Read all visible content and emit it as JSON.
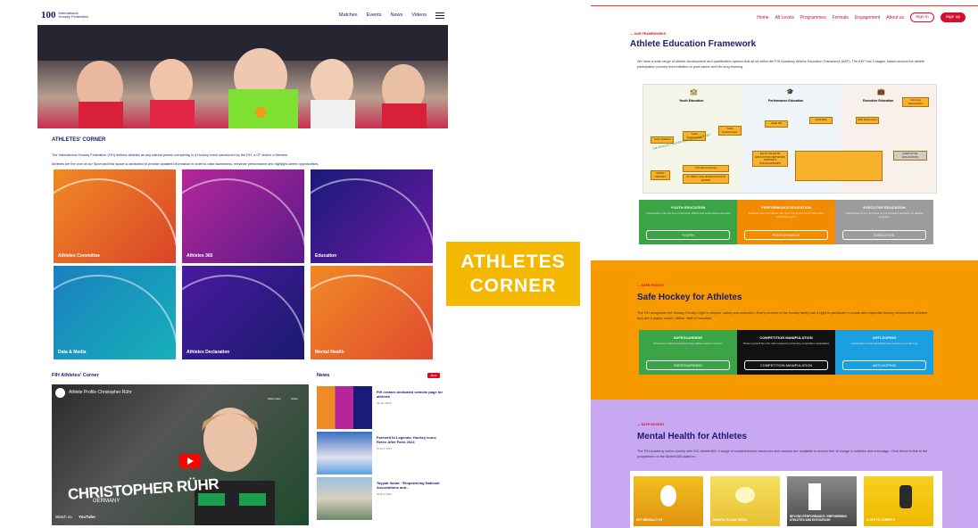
{
  "left": {
    "logo": {
      "number": "100",
      "text": "International Hockey Federation"
    },
    "nav": [
      "Matches",
      "Events",
      "News",
      "Videos"
    ],
    "section_title": "ATHLETES' CORNER",
    "intro1": "The International Hockey Federation (FIH) defines athletes as any natural person competing in a Hockey event sanctioned by the FIH, a CF and/or a Member",
    "intro2": "Athletes are the core of our Sport and this space is dedicated to provide updated information in order to raise awareness, enhance performance and highlight career opportunities.",
    "tiles": [
      "Athletes Committee",
      "Athletes 365",
      "Education",
      "Data & Media",
      "Athletes Declaration",
      "Mental Health"
    ],
    "corner_title": "FIH Athletes' Corner",
    "video": {
      "title": "Athlete Profile Christopher Rühr",
      "name": "CHRISTOPHER RÜHR",
      "country": "GERMANY",
      "watch": "Watch on",
      "yt": "YouTube",
      "later": "Watch later",
      "share": "Share"
    },
    "news_title": "News",
    "news_more": "More",
    "news": [
      {
        "title": "FIH creates dedicated website page for athletes",
        "date": "02 Jan 2025"
      },
      {
        "title": "Farewell to Legends: Hockey Icons Retire After Paris 2024",
        "date": "15 Dec 2024"
      },
      {
        "title": "Tayyab Ikram: \"Empowering National Associations and...",
        "date": "05 Dec 2024"
      }
    ]
  },
  "badge": {
    "line1": "ATHLETES",
    "line2": "CORNER"
  },
  "right": {
    "nav": [
      "Home",
      "All Levels",
      "Programmes",
      "Formats",
      "Engagement",
      "About us"
    ],
    "signin": "Sign in",
    "signup": "Sign up",
    "aef": {
      "eyebrow": "— OUR FRAMEWORKS",
      "title": "Athlete Education Framework",
      "desc": "We have a wide range of athlete development and qualification options that all sit within the FIH Academy Athlete Education Framework (AEF). The AEF has 3 stages, based around the athlete participation journey from initiation to post career and life-long learning.",
      "diagram": {
        "stages": [
          "Youth Education",
          "Performance Education",
          "Executive Education"
        ],
        "boxes": [
          "Youth Initiation",
          "Youth Intermediate",
          "Youth Performance",
          "Adult HP",
          "Adult Elite",
          "Elite Retirement",
          "Life-long Participation"
        ],
        "journey": "THE ATHLETE / PLAYER EDUCATION JOURNEY",
        "start": "START HOCKEY",
        "camps": "FIH World Camps",
        "olympic": "OLYMPIC VALUES EDUCATION (OVEP)",
        "elite": "ELITE ATHLETE EDUCATION NETWORK SUPPORT SCHOLARSHIPS",
        "exec": "EXECUTIVE EDUCATION"
      },
      "cards": [
        {
          "title": "YOUTH EDUCATION",
          "desc": "Gold/Golden is the first area of personal, athletic and performance education",
          "button": "YOUTH",
          "color": "#3aa446"
        },
        {
          "title": "PERFORMANCE EDUCATION",
          "desc": "Available when elite athlete, life, sport and career values during their performance years",
          "button": "PERFORMANCE",
          "color": "#f28b00"
        },
        {
          "title": "EXECUTIVE EDUCATION",
          "desc": "Gold/Golden on the next stage of your executive education for athletes programs",
          "button": "EXECUTIVE",
          "color": "#9c9c9c"
        }
      ]
    },
    "safe": {
      "eyebrow": "— SAFE HOCKEY",
      "title": "Safe Hockey for Athletes",
      "desc": "The FIH recognises the Hockey Family's right to respect, safety and protection. Every member of the hockey family has a right to participate in a safe and respectful hockey environment, whether they are a player, coach, official, staff or volunteer.",
      "cards": [
        {
          "title": "SAFEGUARDING",
          "desc": "Resources, tools and training to help athletes report a concern",
          "button": "SAFEGUARDING",
          "color": "#3aa446"
        },
        {
          "title": "COMPETITION MANIPULATION",
          "desc": "Protect yourself from the risks involved in preventing competition manipulation",
          "button": "COMPETITION MANIPULATION",
          "color": "#111111"
        },
        {
          "title": "ANTI-DOPING",
          "desc": "Gold/Golden on the anti-doping rules to keep you in the loop",
          "button": "ANTI-DOPING",
          "color": "#1a9fe0"
        }
      ]
    },
    "mental": {
      "eyebrow": "— SAFE HOCKEY",
      "title": "Mental Health for Athletes",
      "desc": "The FIH Academy works closely with IOC Athlete365. A range of comprehensive resources and courses are available to access free of charge to athletes and entourage. Click below to link to the programme on the Athlete365 platform.",
      "cards": [
        "GET MENTALLY FIT",
        "MINDFUL SOCIAL MEDIA",
        "BEYOND PERFORMANCE: EMPOWERING ATHLETES AND ENTOURAGE",
        "A LIFE TO COMPETE"
      ]
    }
  }
}
